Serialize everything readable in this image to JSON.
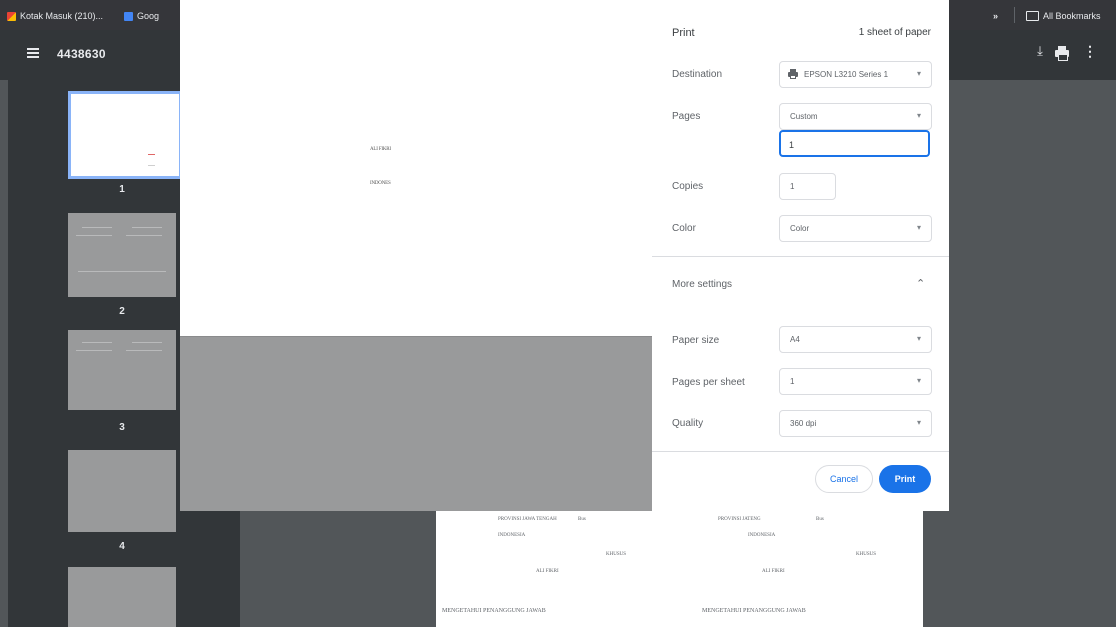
{
  "bookmarks": {
    "items": [
      {
        "label": "Kotak Masuk (210)...",
        "icon": "gmail-icon"
      },
      {
        "label": "Goog",
        "icon": "google-calendar-icon"
      }
    ],
    "overflow": "»",
    "all_bookmarks": "All Bookmarks"
  },
  "toolbar": {
    "title": "4438630",
    "download_icon": "⤓",
    "more_icon": "⋮"
  },
  "sidebar": {
    "pages": [
      "1",
      "2",
      "3",
      "4"
    ],
    "selected_page": 1
  },
  "print_dialog": {
    "title": "Print",
    "sheet_count": "1 sheet of paper",
    "destination": {
      "label": "Destination",
      "value": "EPSON L3210 Series 1"
    },
    "pages": {
      "label": "Pages",
      "value": "Custom",
      "input_value": "1"
    },
    "copies": {
      "label": "Copies",
      "value": "1"
    },
    "color": {
      "label": "Color",
      "value": "Color"
    },
    "more_settings": {
      "label": "More settings",
      "expanded": true
    },
    "paper_size": {
      "label": "Paper size",
      "value": "A4"
    },
    "pages_per_sheet": {
      "label": "Pages per sheet",
      "value": "1"
    },
    "quality": {
      "label": "Quality",
      "value": "360 dpi"
    },
    "cancel_label": "Cancel",
    "print_label": "Print",
    "accent_color": "#1a73e8"
  },
  "document_page": {
    "lines": [
      "PROVINSI JAWA TENGAH",
      "INDONESIA",
      "INDONESIA",
      "ALI FIKRI",
      "ALI FIKRI",
      "MENGETAHUI PENANGGUNG JAWAB",
      "MENGETAHUI PENANGGUNG JAWAB"
    ]
  }
}
